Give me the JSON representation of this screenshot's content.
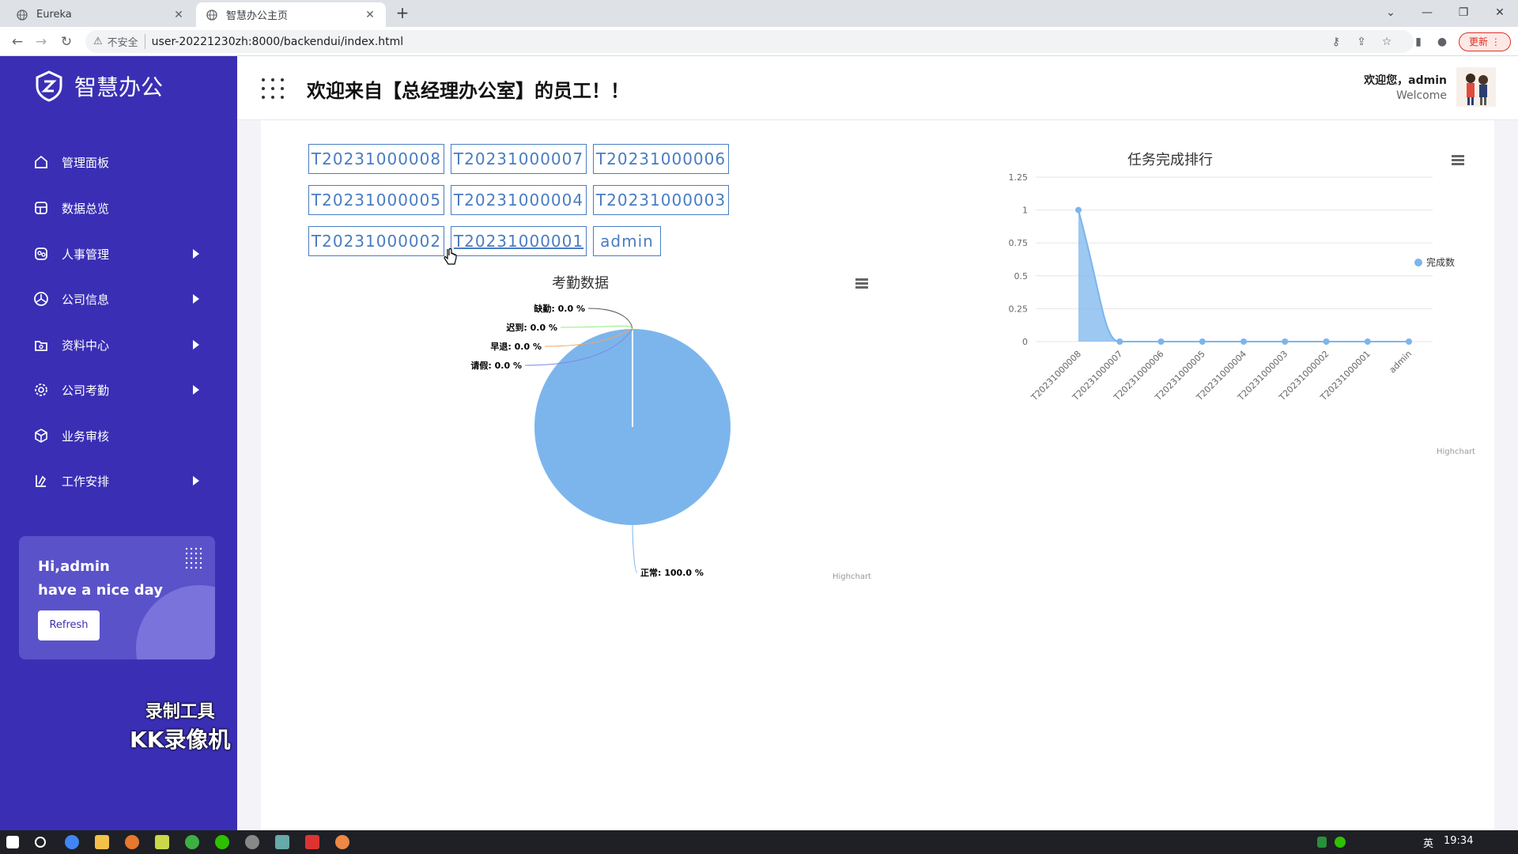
{
  "browser": {
    "tabs": [
      {
        "title": "Eureka",
        "active": false
      },
      {
        "title": "智慧办公主页",
        "active": true
      }
    ],
    "security_label": "不安全",
    "url": "user-20221230zh:8000/backendui/index.html",
    "update_label": "更新"
  },
  "sidebar": {
    "app_name": "智慧办公",
    "items": [
      {
        "label": "管理面板",
        "icon": "home-icon",
        "expandable": false
      },
      {
        "label": "数据总览",
        "icon": "dashboard-icon",
        "expandable": false
      },
      {
        "label": "人事管理",
        "icon": "personnel-icon",
        "expandable": true
      },
      {
        "label": "公司信息",
        "icon": "company-icon",
        "expandable": true
      },
      {
        "label": "资料中心",
        "icon": "folder-icon",
        "expandable": true
      },
      {
        "label": "公司考勤",
        "icon": "gear-icon",
        "expandable": true
      },
      {
        "label": "业务审核",
        "icon": "box-icon",
        "expandable": false
      },
      {
        "label": "工作安排",
        "icon": "schedule-icon",
        "expandable": true
      }
    ],
    "greeting_line1": "Hi,admin",
    "greeting_line2": "have a nice day",
    "refresh_label": "Refresh",
    "watermark_line1": "录制工具",
    "watermark_line2": "KK录像机"
  },
  "header": {
    "title": "欢迎来自【总经理办公室】的员工！！",
    "hello": "欢迎您，admin",
    "hello_sub": "Welcome"
  },
  "user_buttons": [
    "T20231000008",
    "T20231000007",
    "T20231000006",
    "T20231000005",
    "T20231000004",
    "T20231000003",
    "T20231000002",
    "T20231000001",
    "admin"
  ],
  "chart_data": [
    {
      "type": "pie",
      "title": "考勤数据",
      "slices": [
        {
          "name": "缺勤",
          "value": 0.0,
          "label": "缺勤: 0.0 %",
          "color": "#5b5b5b"
        },
        {
          "name": "迟到",
          "value": 0.0,
          "label": "迟到: 0.0 %",
          "color": "#90ed7d"
        },
        {
          "name": "早退",
          "value": 0.0,
          "label": "早退: 0.0 %",
          "color": "#f7a35c"
        },
        {
          "name": "请假",
          "value": 0.0,
          "label": "请假: 0.0 %",
          "color": "#8085e9"
        },
        {
          "name": "正常",
          "value": 100.0,
          "label": "正常: 100.0 %",
          "color": "#7cb5ec"
        }
      ],
      "credit": "Highchart"
    },
    {
      "type": "area",
      "title": "任务完成排行",
      "categories": [
        "T20231000008",
        "T20231000007",
        "T20231000006",
        "T20231000005",
        "T20231000004",
        "T20231000003",
        "T20231000002",
        "T20231000001",
        "admin"
      ],
      "series": [
        {
          "name": "完成数",
          "values": [
            1,
            0,
            0,
            0,
            0,
            0,
            0,
            0,
            0
          ],
          "color": "#7cb5ec"
        }
      ],
      "ylim": [
        0,
        1.25
      ],
      "yticks": [
        "0",
        "0.25",
        "0.5",
        "0.75",
        "1",
        "1.25"
      ],
      "grid": true,
      "legend": "right",
      "credit": "Highchart"
    }
  ],
  "taskbar": {
    "lang": "英",
    "time": "19:34"
  }
}
